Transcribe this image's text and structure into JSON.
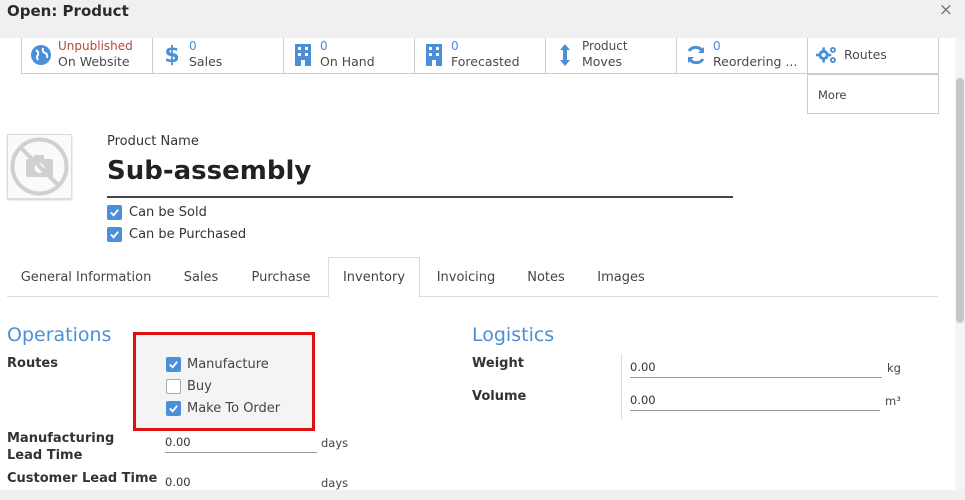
{
  "dialog": {
    "title": "Open: Product",
    "close_glyph": "×"
  },
  "smart_buttons": [
    {
      "line1": "Unpublished",
      "line2": "On Website",
      "icon": "globe-icon"
    },
    {
      "line1": "0",
      "line2": "Sales",
      "icon": "dollar-icon"
    },
    {
      "line1": "0",
      "line2": "On Hand",
      "icon": "building-icon"
    },
    {
      "line1": "0",
      "line2": "Forecasted",
      "icon": "building-icon"
    },
    {
      "line1": "Product",
      "line2": "Moves",
      "icon": "arrows-vertical-icon"
    },
    {
      "line1": "0",
      "line2": "Reordering ...",
      "icon": "refresh-icon"
    },
    {
      "label": "Routes",
      "icon": "cogs-icon"
    }
  ],
  "more_label": "More",
  "product": {
    "name_label": "Product Name",
    "name": "Sub-assembly",
    "can_be_sold": "Can be Sold",
    "can_be_purchased": "Can be Purchased"
  },
  "tabs": [
    "General Information",
    "Sales",
    "Purchase",
    "Inventory",
    "Invoicing",
    "Notes",
    "Images"
  ],
  "active_tab": "Inventory",
  "operations": {
    "title": "Operations",
    "routes_label": "Routes",
    "routes": [
      {
        "label": "Manufacture",
        "checked": true
      },
      {
        "label": "Buy",
        "checked": false
      },
      {
        "label": "Make To Order",
        "checked": true
      }
    ],
    "mfg_lead_label": "Manufacturing Lead Time",
    "mfg_lead_value": "0.00",
    "mfg_lead_unit": "days",
    "cust_lead_label": "Customer Lead Time",
    "cust_lead_value": "0.00",
    "cust_lead_unit": "days"
  },
  "logistics": {
    "title": "Logistics",
    "weight_label": "Weight",
    "weight_value": "0.00",
    "weight_unit": "kg",
    "volume_label": "Volume",
    "volume_value": "0.00",
    "volume_unit": "m³"
  },
  "colors": {
    "accent": "#4a8fd8",
    "highlight": "#e01010",
    "published_red": "#b04a3a"
  }
}
